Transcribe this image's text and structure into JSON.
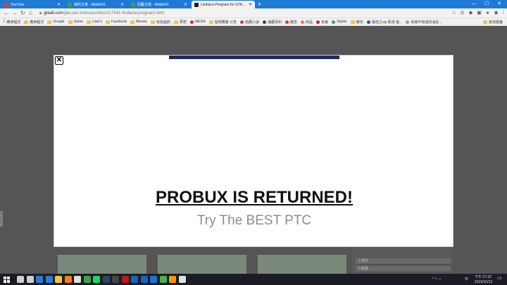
{
  "browser": {
    "tabs": [
      {
        "title": "YouTube",
        "favicon_color": "#e53935",
        "active": false
      },
      {
        "title": "我的文章 - Mobile01",
        "favicon_color": "#43a047",
        "active": false
      },
      {
        "title": "回覆主題 - Mobile01",
        "favicon_color": "#43a047",
        "active": false
      },
      {
        "title": "Lindiana Pregnant for GTA San...",
        "favicon_color": "#212121",
        "active": true
      }
    ],
    "new_tab_label": "+",
    "window_controls": {
      "minimize": "—",
      "maximize": "☐",
      "close": "✕"
    },
    "nav": {
      "back": "←",
      "forward": "→",
      "reload": "↻",
      "home": "⌂"
    },
    "url": {
      "domain": "gtaall.com",
      "path": "/gta-san-andreas/skins/117941-lindiana-pregnant.html"
    },
    "bookmarks": [
      {
        "label": "應用程式",
        "kind": "apps"
      },
      {
        "label": "應用程式",
        "kind": "folder"
      },
      {
        "label": "Google",
        "kind": "folder"
      },
      {
        "label": "Game",
        "kind": "folder"
      },
      {
        "label": "User's",
        "kind": "folder"
      },
      {
        "label": "Facebook",
        "kind": "folder"
      },
      {
        "label": "Movies",
        "kind": "folder"
      },
      {
        "label": "有找過的",
        "kind": "folder"
      },
      {
        "label": "夢想",
        "kind": "folder"
      },
      {
        "label": "MEGA",
        "kind": "dot",
        "color": "#d32f2f"
      },
      {
        "label": "鼠標應援 公告",
        "kind": "folder"
      },
      {
        "label": "拓展小說",
        "kind": "dot",
        "color": "#e53935"
      },
      {
        "label": "識趣百科",
        "kind": "dot",
        "color": "#444444"
      },
      {
        "label": "觀念",
        "kind": "dot",
        "color": "#e53935"
      },
      {
        "label": "商品",
        "kind": "dot",
        "color": "#ff7043"
      },
      {
        "label": "京東",
        "kind": "dot",
        "color": "#c62828"
      },
      {
        "label": "Stylish",
        "kind": "dot",
        "color": "#43a047"
      },
      {
        "label": "聊天",
        "kind": "folder"
      },
      {
        "label": "最佳之vip 影視 首...",
        "kind": "dot",
        "color": "#8e24aa"
      },
      {
        "label": "有我不知道的消息...",
        "kind": "dot",
        "color": "#9e9e9e"
      }
    ],
    "bookmarks_other": "其他書籤"
  },
  "modal": {
    "close_label": "✕",
    "headline": "PROBUX IS RETURNED!",
    "subtext": "Try The BEST PTC"
  },
  "background_page": {
    "sidebar_rows": [
      "上傳日",
      "下載量"
    ]
  },
  "taskbar": {
    "clock_time": "下午 07:32",
    "clock_date": "2019/10/13",
    "tray_text": "中",
    "icons": [
      {
        "name": "search-icon",
        "color": "#cfcfcf"
      },
      {
        "name": "task-view-icon",
        "color": "#cfcfcf"
      },
      {
        "name": "edge-icon",
        "color": "#2b7bd6"
      },
      {
        "name": "store-icon",
        "color": "#2b7bd6"
      },
      {
        "name": "file-explorer-icon",
        "color": "#f5c542"
      },
      {
        "name": "firefox-icon",
        "color": "#ff7a1a"
      },
      {
        "name": "app-icon",
        "color": "#e0e0e0"
      },
      {
        "name": "app-icon",
        "color": "#3fa34d"
      },
      {
        "name": "spotify-icon",
        "color": "#1ed760"
      },
      {
        "name": "steam-icon",
        "color": "#2a475e"
      },
      {
        "name": "app-icon",
        "color": "#444444"
      },
      {
        "name": "app-icon",
        "color": "#b71c1c"
      },
      {
        "name": "app-icon",
        "color": "#1565c0"
      },
      {
        "name": "app-icon",
        "color": "#1565c0"
      },
      {
        "name": "app-icon",
        "color": "#1976d2"
      },
      {
        "name": "chrome-icon",
        "color": "#4caf50"
      },
      {
        "name": "app-icon",
        "color": "#ff9800"
      },
      {
        "name": "app-icon",
        "color": "#e0e0e0"
      }
    ]
  }
}
